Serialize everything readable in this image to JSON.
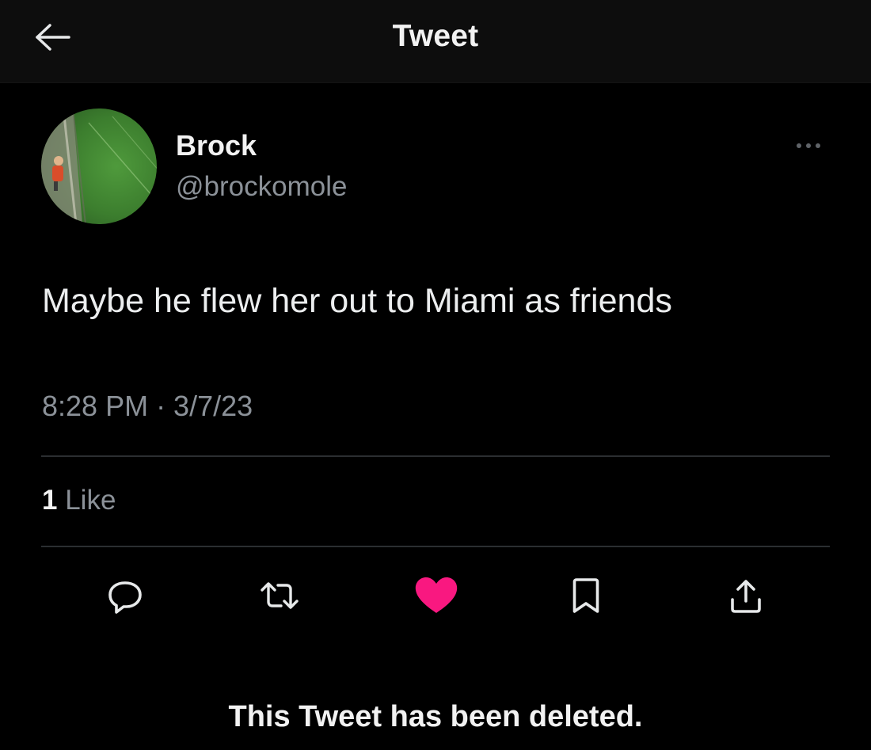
{
  "header": {
    "title": "Tweet",
    "back_icon": "arrow-left-icon"
  },
  "tweet": {
    "author": {
      "name": "Brock",
      "handle": "@brockomole",
      "avatar_icon": "avatar-photo"
    },
    "more_icon": "more-dots-icon",
    "text": "Maybe he flew her out to Miami as friends",
    "timestamp": "8:28 PM · 3/7/23",
    "likes": {
      "count": "1",
      "label": "Like"
    },
    "actions": [
      {
        "icon": "reply-icon",
        "active": false
      },
      {
        "icon": "retweet-icon",
        "active": false
      },
      {
        "icon": "heart-icon",
        "active": true
      },
      {
        "icon": "bookmark-icon",
        "active": false
      },
      {
        "icon": "share-icon",
        "active": false
      }
    ]
  },
  "notice": "This Tweet has been deleted.",
  "colors": {
    "background": "#000000",
    "header_background": "#0d0d0d",
    "text_primary": "#e7e9ea",
    "text_secondary": "#8b9198",
    "divider": "#2b2e31",
    "like_active": "#f91880"
  }
}
